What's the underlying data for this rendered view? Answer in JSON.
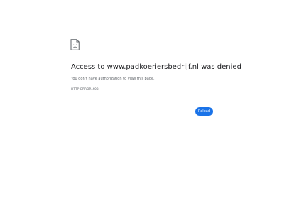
{
  "error": {
    "icon": "sad-document-icon",
    "title": "Access to www.padkoeriersbedrijf.nl was denied",
    "description": "You don't have authorization to view this page.",
    "code": "HTTP ERROR 403"
  },
  "actions": {
    "reload_label": "Reload"
  },
  "colors": {
    "accent": "#1a73e8",
    "text": "#202124",
    "muted": "#5f6368",
    "background": "#ffffff"
  }
}
